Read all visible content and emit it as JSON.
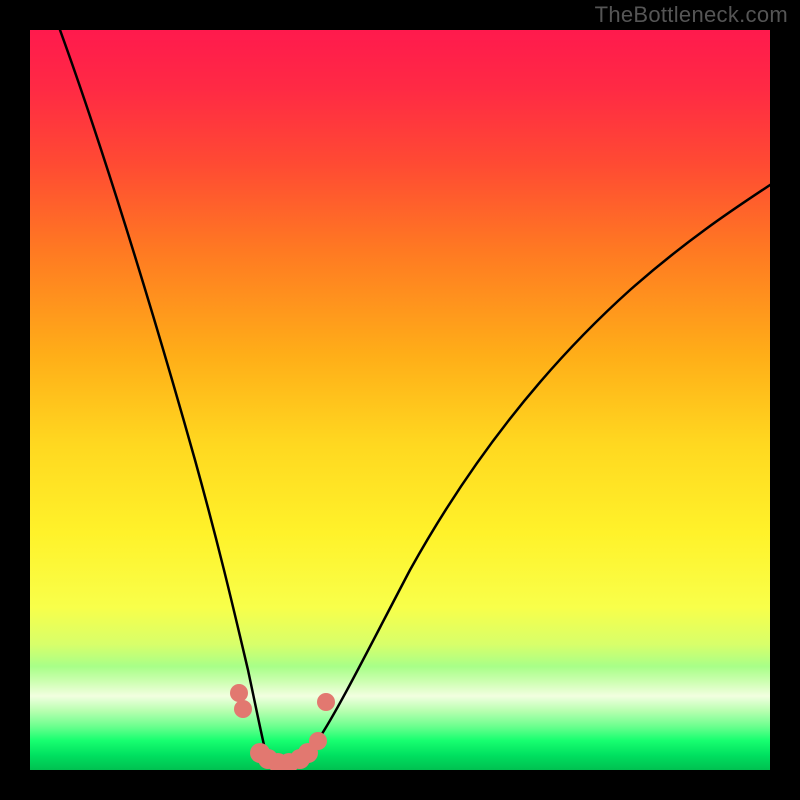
{
  "watermark": "TheBottleneck.com",
  "colors": {
    "background": "#000000",
    "gradient_top": "#ff1a4d",
    "gradient_mid": "#fff22a",
    "gradient_bottom": "#00c050",
    "curve": "#000000",
    "dots": "#e27870"
  },
  "chart_data": {
    "type": "line",
    "title": "",
    "xlabel": "",
    "ylabel": "",
    "x_range": [
      0,
      100
    ],
    "y_range": [
      0,
      100
    ],
    "series": [
      {
        "name": "curve-left",
        "x": [
          4,
          8,
          12,
          16,
          20,
          23,
          25,
          27,
          28.5,
          30,
          31
        ],
        "y": [
          100,
          84,
          68,
          52,
          37,
          24,
          16,
          10,
          6,
          3,
          1.5
        ]
      },
      {
        "name": "curve-right",
        "x": [
          37,
          39,
          42,
          46,
          51,
          57,
          64,
          72,
          81,
          90,
          100
        ],
        "y": [
          1.5,
          3,
          6,
          12,
          20,
          30,
          42,
          54,
          65,
          74,
          82
        ]
      },
      {
        "name": "dots",
        "x": [
          28,
          28.5,
          30.5,
          31.5,
          33,
          34.5,
          36,
          37,
          38.5,
          39.5
        ],
        "y": [
          10,
          8,
          1.5,
          1,
          0.5,
          0.5,
          1,
          1.5,
          3,
          8
        ],
        "marker": "circle",
        "color": "#e27870"
      }
    ],
    "notes": "Axes are unlabelled; values are read off as percentage of the visible gradient area (0 = bottom/left edge, 100 = top/right edge). The figure shows a sharp V-shaped dip reaching the green band, with salmon dots clustered at the valley."
  }
}
